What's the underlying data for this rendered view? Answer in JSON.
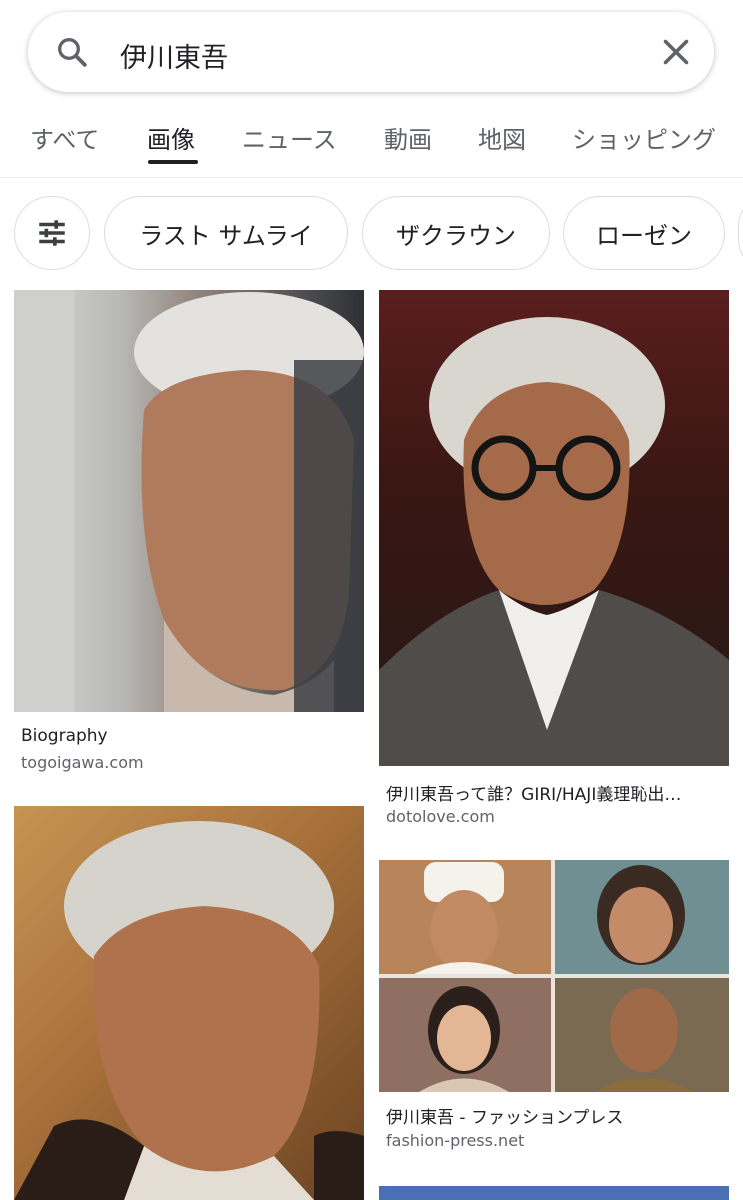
{
  "search": {
    "query": "伊川東吾"
  },
  "tabs": [
    {
      "label": "すべて"
    },
    {
      "label": "画像",
      "active": true
    },
    {
      "label": "ニュース"
    },
    {
      "label": "動画"
    },
    {
      "label": "地図"
    },
    {
      "label": "ショッピング"
    }
  ],
  "chips": [
    {
      "label": "ラスト サムライ"
    },
    {
      "label": "ザクラウン"
    },
    {
      "label": "ローゼン"
    }
  ],
  "results": [
    {
      "title": "Biography",
      "domain": "togoigawa.com"
    },
    {
      "title": "伊川東吾って誰？GIRI/HAJI義理恥出…",
      "domain": "dotolove.com"
    },
    {
      "title": "伊川東吾 - ファッションプレス",
      "domain": "fashion-press.net"
    }
  ],
  "colors": {
    "text": "#202124",
    "secondary_text": "#5f6368",
    "chip_border": "#dadce0"
  }
}
